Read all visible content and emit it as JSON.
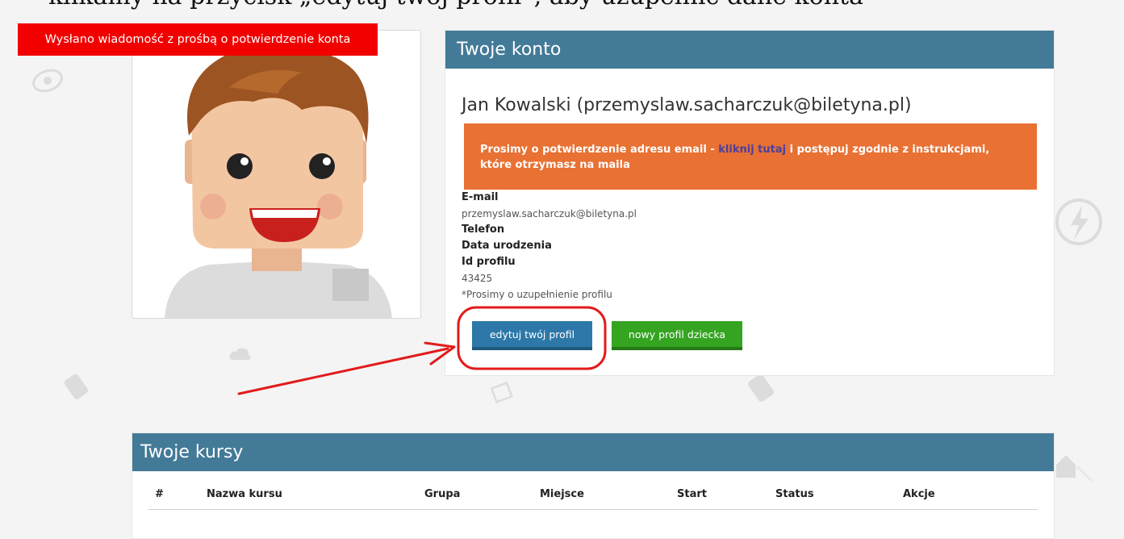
{
  "top_cut_text": "klikamy na przycisk „edytuj twój profil”, aby uzupełnić dane konta",
  "toast": {
    "message": "Wysłano wiadomość z prośbą o potwierdzenie konta"
  },
  "account": {
    "title": "Twoje konto",
    "user_name": "Jan Kowalski (przemyslaw.sacharczuk@biletyna.pl)",
    "alert": {
      "prefix": "Prosimy o potwierdzenie adresu email - ",
      "link": "kliknij tutaj",
      "suffix": " i postępuj zgodnie z instrukcjami, które otrzymasz na maila"
    },
    "details": {
      "email_label": "E-mail",
      "email_value": "przemyslaw.sacharczuk@biletyna.pl",
      "phone_label": "Telefon",
      "birth_label": "Data urodzenia",
      "profile_id_label": "Id profilu",
      "profile_id_value": "43425",
      "note": "*Prosimy o uzupełnienie profilu"
    },
    "buttons": {
      "edit_profile": "edytuj twój profil",
      "new_child_profile": "nowy profil dziecka"
    }
  },
  "courses": {
    "title": "Twoje kursy",
    "columns": [
      "#",
      "Nazwa kursu",
      "Grupa",
      "Miejsce",
      "Start",
      "Status",
      "Akcje"
    ]
  },
  "colors": {
    "header_blue": "#437a98",
    "alert_orange": "#e87133",
    "toast_red": "#f20000",
    "edit_button": "#2d78a8",
    "child_button": "#34a421",
    "annotation_red": "#e21b1b"
  }
}
